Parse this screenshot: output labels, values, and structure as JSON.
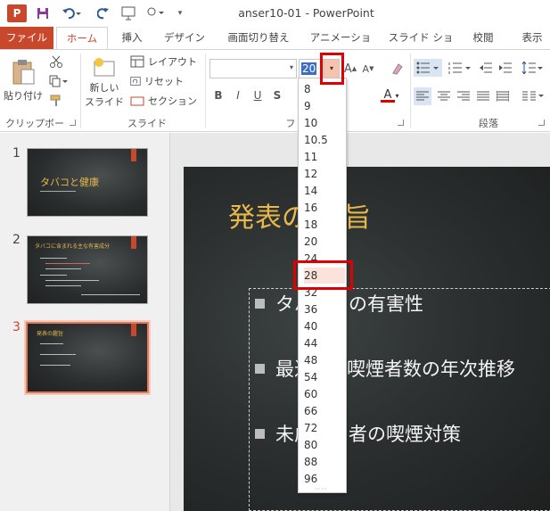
{
  "window": {
    "title": "anser10-01 - PowerPoint",
    "app_logo": "P"
  },
  "tabs": [
    "ファイル",
    "ホーム",
    "挿入",
    "デザイン",
    "画面切り替え",
    "アニメーション",
    "スライド ショー",
    "校閲",
    "表示"
  ],
  "ribbon": {
    "clipboard": {
      "label": "クリップボード",
      "paste": "貼り付け"
    },
    "slides": {
      "label": "スライド",
      "new_slide_line1": "新しい",
      "new_slide_line2": "スライド",
      "layout": "レイアウト",
      "reset": "リセット",
      "section": "セクション"
    },
    "font": {
      "label": "フォ",
      "size_value": "20"
    },
    "paragraph": {
      "label": "段落"
    }
  },
  "font_size_options": [
    "8",
    "9",
    "10",
    "10.5",
    "11",
    "12",
    "14",
    "16",
    "18",
    "20",
    "24",
    "28",
    "32",
    "36",
    "40",
    "44",
    "48",
    "54",
    "60",
    "66",
    "72",
    "80",
    "88",
    "96"
  ],
  "font_size_highlighted": "28",
  "slides": [
    {
      "num": "1",
      "title": "タバコと健康"
    },
    {
      "num": "2",
      "title": "タバコに含まれる主な有害成分"
    },
    {
      "num": "3",
      "title": "発表の趣旨"
    }
  ],
  "current_slide": {
    "title_visible": "発表の",
    "title_tail": "旨",
    "bullets": [
      {
        "a": "タバ",
        "b": "の有害性"
      },
      {
        "a": "最近",
        "b": "喫煙者数の年次推移"
      },
      {
        "a": "未成",
        "b": "者の喫煙対策"
      }
    ]
  },
  "colors": {
    "accent": "#c9472b",
    "title_gold": "#e8b84a",
    "highlight": "#e00000"
  }
}
